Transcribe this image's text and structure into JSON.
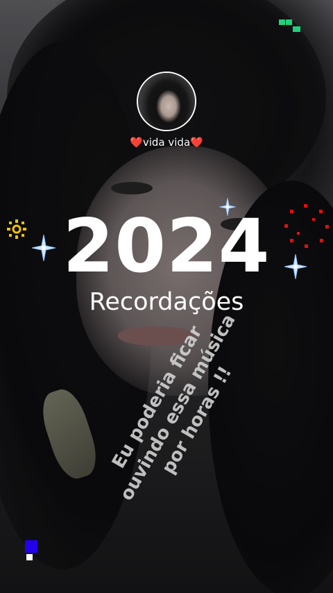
{
  "story": {
    "username": "❤️vida vida❤️",
    "year": "2024",
    "subtitle": "Recordações",
    "caption_lines": [
      "Eu poderia ficar",
      "ouvindo essa música",
      "por horas  !!"
    ]
  },
  "colors": {
    "text": "#ffffff",
    "caption": "#d2d2d2",
    "sparkle": "#a8d4ff",
    "yellow_deco": "#f2c400",
    "red_deco": "#e01010",
    "green_deco": "#1fd17a",
    "blue_deco": "#2200ee"
  },
  "icons": [
    "sparkle-icon",
    "sun-icon",
    "dotted-ring-icon",
    "pixel-deco-icon"
  ]
}
